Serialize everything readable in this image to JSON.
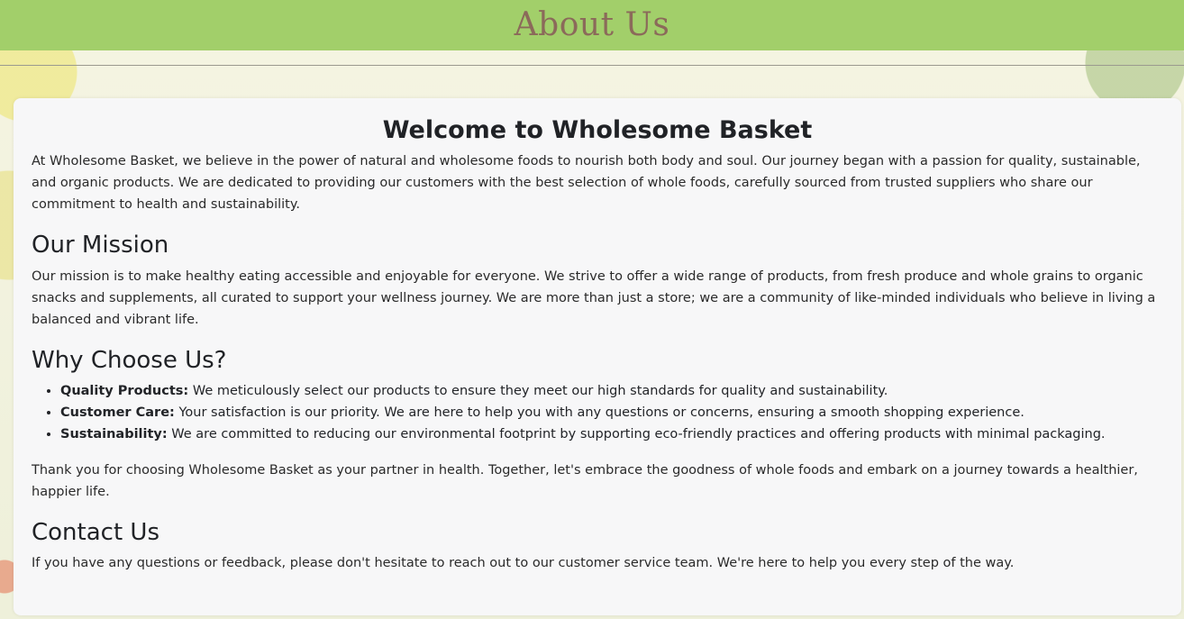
{
  "header": {
    "title": "About Us"
  },
  "main": {
    "title": "Welcome to Wholesome Basket",
    "intro": "At Wholesome Basket, we believe in the power of natural and wholesome foods to nourish both body and soul. Our journey began with a passion for quality, sustainable, and organic products. We are dedicated to providing our customers with the best selection of whole foods, carefully sourced from trusted suppliers who share our commitment to health and sustainability."
  },
  "mission": {
    "title": "Our Mission",
    "text": "Our mission is to make healthy eating accessible and enjoyable for everyone. We strive to offer a wide range of products, from fresh produce and whole grains to organic snacks and supplements, all curated to support your wellness journey. We are more than just a store; we are a community of like-minded individuals who believe in living a balanced and vibrant life."
  },
  "why": {
    "title": "Why Choose Us?",
    "items": [
      {
        "name": "Quality Products:",
        "text": " We meticulously select our products to ensure they meet our high standards for quality and sustainability."
      },
      {
        "name": "Customer Care:",
        "text": " Your satisfaction is our priority. We are here to help you with any questions or concerns, ensuring a smooth shopping experience."
      },
      {
        "name": "Sustainability:",
        "text": " We are committed to reducing our environmental footprint by supporting eco-friendly practices and offering products with minimal packaging."
      }
    ],
    "thanks": "Thank you for choosing Wholesome Basket as your partner in health. Together, let's embrace the goodness of whole foods and embark on a journey towards a healthier, happier life."
  },
  "contact": {
    "title": "Contact Us",
    "text": "If you have any questions or feedback, please don't hesitate to reach out to our customer service team. We're here to help you every step of the way."
  },
  "colors": {
    "header_bg": "#a2cf6a",
    "header_text": "#8b6a5a",
    "card_bg": "#f7f7f8"
  }
}
